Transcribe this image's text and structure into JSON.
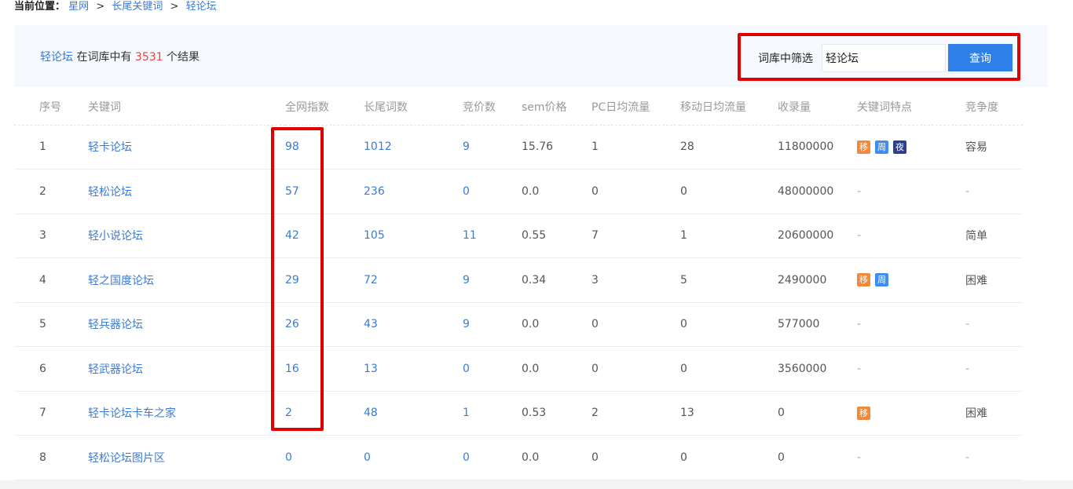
{
  "breadcrumb": {
    "label": "当前位置：",
    "items": [
      "星网",
      "长尾关键词",
      "轻论坛"
    ],
    "separator": ">"
  },
  "summary": {
    "keyword": "轻论坛",
    "text_before": " 在词库中有 ",
    "count": "3531",
    "text_after": " 个结果"
  },
  "filter": {
    "label": "词库中筛选",
    "value": "轻论坛",
    "button": "查询"
  },
  "table": {
    "headers": [
      "序号",
      "关键词",
      "全网指数",
      "长尾词数",
      "竞价数",
      "sem价格",
      "PC日均流量",
      "移动日均流量",
      "收录量",
      "关键词特点",
      "竞争度"
    ],
    "rows": [
      {
        "idx": "1",
        "keyword": "轻卡论坛",
        "index": "98",
        "longtail": "1012",
        "bid": "9",
        "sem": "15.76",
        "pc": "1",
        "mobile": "28",
        "indexed": "11800000",
        "features": [
          "移",
          "周",
          "夜"
        ],
        "feature_types": [
          "move",
          "week",
          "night"
        ],
        "competition": "容易"
      },
      {
        "idx": "2",
        "keyword": "轻松论坛",
        "index": "57",
        "longtail": "236",
        "bid": "0",
        "sem": "0.0",
        "pc": "0",
        "mobile": "0",
        "indexed": "48000000",
        "features": [],
        "feature_types": [],
        "competition": "-"
      },
      {
        "idx": "3",
        "keyword": "轻小说论坛",
        "index": "42",
        "longtail": "105",
        "bid": "11",
        "sem": "0.55",
        "pc": "7",
        "mobile": "1",
        "indexed": "20600000",
        "features": [],
        "feature_types": [],
        "competition": "简单"
      },
      {
        "idx": "4",
        "keyword": "轻之国度论坛",
        "index": "29",
        "longtail": "72",
        "bid": "9",
        "sem": "0.34",
        "pc": "3",
        "mobile": "5",
        "indexed": "2490000",
        "features": [
          "移",
          "周"
        ],
        "feature_types": [
          "move",
          "week"
        ],
        "competition": "困难"
      },
      {
        "idx": "5",
        "keyword": "轻兵器论坛",
        "index": "26",
        "longtail": "43",
        "bid": "9",
        "sem": "0.0",
        "pc": "0",
        "mobile": "0",
        "indexed": "577000",
        "features": [],
        "feature_types": [],
        "competition": "-"
      },
      {
        "idx": "6",
        "keyword": "轻武器论坛",
        "index": "16",
        "longtail": "13",
        "bid": "0",
        "sem": "0.0",
        "pc": "0",
        "mobile": "0",
        "indexed": "3560000",
        "features": [],
        "feature_types": [],
        "competition": "-"
      },
      {
        "idx": "7",
        "keyword": "轻卡论坛卡车之家",
        "index": "2",
        "longtail": "48",
        "bid": "1",
        "sem": "0.53",
        "pc": "2",
        "mobile": "13",
        "indexed": "0",
        "features": [
          "移"
        ],
        "feature_types": [
          "move"
        ],
        "competition": "困难"
      },
      {
        "idx": "8",
        "keyword": "轻松论坛图片区",
        "index": "0",
        "longtail": "0",
        "bid": "0",
        "sem": "0.0",
        "pc": "0",
        "mobile": "0",
        "indexed": "0",
        "features": [],
        "feature_types": [],
        "competition": "-"
      }
    ]
  },
  "colors": {
    "link": "#3a7bd5",
    "count": "#e8453c",
    "button": "#2f7fe8",
    "highlight": "#e00000",
    "tag_move": "#f08a3a",
    "tag_week": "#3e8ef2",
    "tag_night": "#2a3f8f"
  }
}
